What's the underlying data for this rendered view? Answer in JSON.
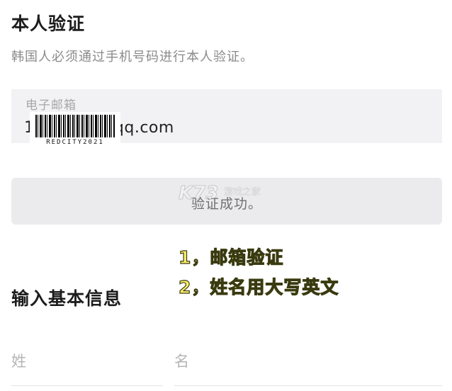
{
  "verification": {
    "title": "本人验证",
    "subtitle": "韩国人必须通过手机号码进行本人验证。",
    "email_label": "电子邮箱",
    "email_value": "1            @qq.com",
    "barcode_text": "REDCITY2021",
    "button_label": "验证成功。"
  },
  "watermark": {
    "logo": "K73",
    "text": "游戏之家"
  },
  "annotations": {
    "line1": "1，邮箱验证",
    "line2": "2，姓名用大写英文"
  },
  "basic_info": {
    "title": "输入基本信息",
    "last_name_placeholder": "姓",
    "first_name_placeholder": "名"
  }
}
